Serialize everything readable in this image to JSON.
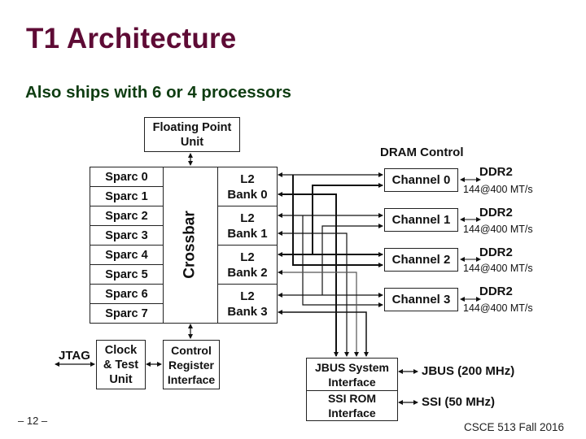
{
  "slide": {
    "title": "T1 Architecture",
    "subtitle": "Also ships with 6 or 4 processors",
    "page_number": "– 12 –",
    "course": "CSCE 513 Fall 2016"
  },
  "diagram": {
    "fpu": {
      "line1": "Floating Point",
      "line2": "Unit"
    },
    "sparc_cores": [
      "Sparc 0",
      "Sparc 1",
      "Sparc 2",
      "Sparc 3",
      "Sparc 4",
      "Sparc 5",
      "Sparc 6",
      "Sparc 7"
    ],
    "crossbar": "Crossbar",
    "l2_banks": [
      {
        "line1": "L2",
        "line2": "Bank 0"
      },
      {
        "line1": "L2",
        "line2": "Bank 1"
      },
      {
        "line1": "L2",
        "line2": "Bank 2"
      },
      {
        "line1": "L2",
        "line2": "Bank 3"
      }
    ],
    "dram_control_label": "DRAM Control",
    "channels": [
      {
        "name": "Channel 0",
        "mem": "DDR2",
        "rate": "144@400 MT/s"
      },
      {
        "name": "Channel 1",
        "mem": "DDR2",
        "rate": "144@400 MT/s"
      },
      {
        "name": "Channel 2",
        "mem": "DDR2",
        "rate": "144@400 MT/s"
      },
      {
        "name": "Channel 3",
        "mem": "DDR2",
        "rate": "144@400 MT/s"
      }
    ],
    "jtag": "JTAG",
    "clock_test": {
      "line1": "Clock",
      "line2": "& Test",
      "line3": "Unit"
    },
    "control_register": {
      "line1": "Control",
      "line2": "Register",
      "line3": "Interface"
    },
    "jbus_interface": {
      "line1": "JBUS System",
      "line2": "Interface"
    },
    "ssi_interface": {
      "line1": "SSI ROM",
      "line2": "Interface"
    },
    "jbus_label": "JBUS (200 MHz)",
    "ssi_label": "SSI (50 MHz)"
  }
}
